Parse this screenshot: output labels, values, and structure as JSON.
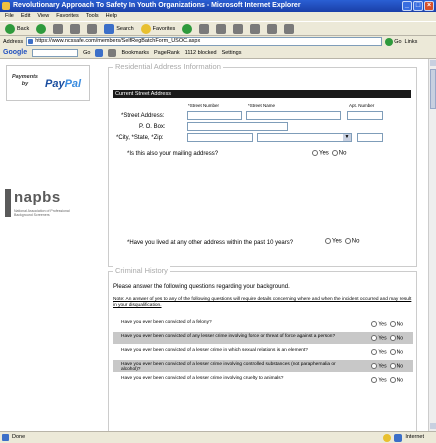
{
  "window": {
    "title": "Revolutionary Approach To Safety In Youth Organizations - Microsoft Internet Explorer"
  },
  "menu": [
    "File",
    "Edit",
    "View",
    "Favorites",
    "Tools",
    "Help"
  ],
  "toolbar": {
    "back": "Back",
    "search": "Search",
    "favorites": "Favorites"
  },
  "address": {
    "label": "Address",
    "url": "https://www.ncssafe.com/members/SelfRegBatchForm_USOC.aspx",
    "go": "Go",
    "links": "Links"
  },
  "googlebar": {
    "logo": "Google",
    "go": "Go",
    "bookmarks": "Bookmarks",
    "pagerank": "PageRank",
    "blocked": "1112 blocked",
    "settings": "Settings"
  },
  "sidebar": {
    "paypal_small": "Payments by",
    "paypal_logo_a": "Pay",
    "paypal_logo_b": "Pal",
    "napbs": "napbs",
    "napbs_sub": "National Association of Professional Background Screeners"
  },
  "address_section": {
    "title": "Residential Address Information",
    "bar": "Current Street Address",
    "col_number": "*Street Number",
    "col_name": "*Street Name",
    "col_apt": "Apt. Number",
    "street_label": "*Street Address:",
    "po_label": "P. O. Box:",
    "csz_label": "*City, *State, *Zip:",
    "mailing_q": "*Is this also your mailing address?",
    "past_q": "*Have you lived at any other address within the past 10 years?",
    "yes": "Yes",
    "no": "No"
  },
  "criminal_section": {
    "title": "Criminal History",
    "intro": "Please answer the following questions regarding your background.",
    "note": "Note: An answer of yes to any of the following questions will require details concerning where and when the incident occurred and may result in your disqualification.",
    "yes": "Yes",
    "no": "No",
    "questions": [
      "Have you ever been convicted of a felony?",
      "Have you ever been convicted of any lesser crime involving force or threat of force against a person?",
      "Have you ever been convicted of a lesser crime in which sexual relations is an element?",
      "Have you ever been convicted of a lesser crime involving controlled substances (not paraphernalia or alcohol)?",
      "Have you ever been convicted of a lesser crime involving cruelty to animals?"
    ]
  },
  "status": {
    "text": "Done",
    "zone": "Internet"
  }
}
